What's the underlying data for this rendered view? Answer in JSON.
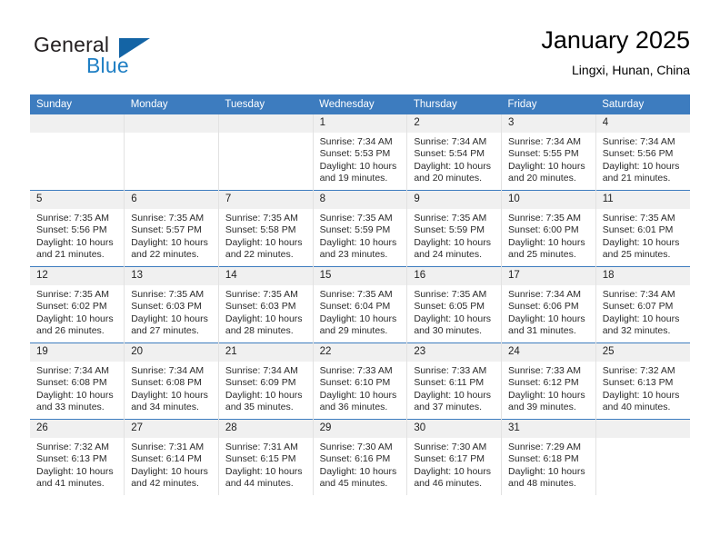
{
  "logo": {
    "line1": "General",
    "line2": "Blue",
    "triangle_icon": "triangle-icon",
    "color_dark": "#231f20",
    "color_blue": "#1f7fc4",
    "color_triangle": "#1464a5"
  },
  "header": {
    "title": "January 2025",
    "subtitle": "Lingxi, Hunan, China"
  },
  "theme": {
    "header_blue": "#3d7cbf",
    "daynum_bg": "#f0f0f0",
    "cell_bg": "#ffffff",
    "text": "#2a2a2a"
  },
  "weekdays": [
    "Sunday",
    "Monday",
    "Tuesday",
    "Wednesday",
    "Thursday",
    "Friday",
    "Saturday"
  ],
  "weeks": [
    [
      {
        "day": "",
        "blank": true
      },
      {
        "day": "",
        "blank": true
      },
      {
        "day": "",
        "blank": true
      },
      {
        "day": "1",
        "sunrise": "Sunrise: 7:34 AM",
        "sunset": "Sunset: 5:53 PM",
        "daylight": "Daylight: 10 hours and 19 minutes."
      },
      {
        "day": "2",
        "sunrise": "Sunrise: 7:34 AM",
        "sunset": "Sunset: 5:54 PM",
        "daylight": "Daylight: 10 hours and 20 minutes."
      },
      {
        "day": "3",
        "sunrise": "Sunrise: 7:34 AM",
        "sunset": "Sunset: 5:55 PM",
        "daylight": "Daylight: 10 hours and 20 minutes."
      },
      {
        "day": "4",
        "sunrise": "Sunrise: 7:34 AM",
        "sunset": "Sunset: 5:56 PM",
        "daylight": "Daylight: 10 hours and 21 minutes."
      }
    ],
    [
      {
        "day": "5",
        "sunrise": "Sunrise: 7:35 AM",
        "sunset": "Sunset: 5:56 PM",
        "daylight": "Daylight: 10 hours and 21 minutes."
      },
      {
        "day": "6",
        "sunrise": "Sunrise: 7:35 AM",
        "sunset": "Sunset: 5:57 PM",
        "daylight": "Daylight: 10 hours and 22 minutes."
      },
      {
        "day": "7",
        "sunrise": "Sunrise: 7:35 AM",
        "sunset": "Sunset: 5:58 PM",
        "daylight": "Daylight: 10 hours and 22 minutes."
      },
      {
        "day": "8",
        "sunrise": "Sunrise: 7:35 AM",
        "sunset": "Sunset: 5:59 PM",
        "daylight": "Daylight: 10 hours and 23 minutes."
      },
      {
        "day": "9",
        "sunrise": "Sunrise: 7:35 AM",
        "sunset": "Sunset: 5:59 PM",
        "daylight": "Daylight: 10 hours and 24 minutes."
      },
      {
        "day": "10",
        "sunrise": "Sunrise: 7:35 AM",
        "sunset": "Sunset: 6:00 PM",
        "daylight": "Daylight: 10 hours and 25 minutes."
      },
      {
        "day": "11",
        "sunrise": "Sunrise: 7:35 AM",
        "sunset": "Sunset: 6:01 PM",
        "daylight": "Daylight: 10 hours and 25 minutes."
      }
    ],
    [
      {
        "day": "12",
        "sunrise": "Sunrise: 7:35 AM",
        "sunset": "Sunset: 6:02 PM",
        "daylight": "Daylight: 10 hours and 26 minutes."
      },
      {
        "day": "13",
        "sunrise": "Sunrise: 7:35 AM",
        "sunset": "Sunset: 6:03 PM",
        "daylight": "Daylight: 10 hours and 27 minutes."
      },
      {
        "day": "14",
        "sunrise": "Sunrise: 7:35 AM",
        "sunset": "Sunset: 6:03 PM",
        "daylight": "Daylight: 10 hours and 28 minutes."
      },
      {
        "day": "15",
        "sunrise": "Sunrise: 7:35 AM",
        "sunset": "Sunset: 6:04 PM",
        "daylight": "Daylight: 10 hours and 29 minutes."
      },
      {
        "day": "16",
        "sunrise": "Sunrise: 7:35 AM",
        "sunset": "Sunset: 6:05 PM",
        "daylight": "Daylight: 10 hours and 30 minutes."
      },
      {
        "day": "17",
        "sunrise": "Sunrise: 7:34 AM",
        "sunset": "Sunset: 6:06 PM",
        "daylight": "Daylight: 10 hours and 31 minutes."
      },
      {
        "day": "18",
        "sunrise": "Sunrise: 7:34 AM",
        "sunset": "Sunset: 6:07 PM",
        "daylight": "Daylight: 10 hours and 32 minutes."
      }
    ],
    [
      {
        "day": "19",
        "sunrise": "Sunrise: 7:34 AM",
        "sunset": "Sunset: 6:08 PM",
        "daylight": "Daylight: 10 hours and 33 minutes."
      },
      {
        "day": "20",
        "sunrise": "Sunrise: 7:34 AM",
        "sunset": "Sunset: 6:08 PM",
        "daylight": "Daylight: 10 hours and 34 minutes."
      },
      {
        "day": "21",
        "sunrise": "Sunrise: 7:34 AM",
        "sunset": "Sunset: 6:09 PM",
        "daylight": "Daylight: 10 hours and 35 minutes."
      },
      {
        "day": "22",
        "sunrise": "Sunrise: 7:33 AM",
        "sunset": "Sunset: 6:10 PM",
        "daylight": "Daylight: 10 hours and 36 minutes."
      },
      {
        "day": "23",
        "sunrise": "Sunrise: 7:33 AM",
        "sunset": "Sunset: 6:11 PM",
        "daylight": "Daylight: 10 hours and 37 minutes."
      },
      {
        "day": "24",
        "sunrise": "Sunrise: 7:33 AM",
        "sunset": "Sunset: 6:12 PM",
        "daylight": "Daylight: 10 hours and 39 minutes."
      },
      {
        "day": "25",
        "sunrise": "Sunrise: 7:32 AM",
        "sunset": "Sunset: 6:13 PM",
        "daylight": "Daylight: 10 hours and 40 minutes."
      }
    ],
    [
      {
        "day": "26",
        "sunrise": "Sunrise: 7:32 AM",
        "sunset": "Sunset: 6:13 PM",
        "daylight": "Daylight: 10 hours and 41 minutes."
      },
      {
        "day": "27",
        "sunrise": "Sunrise: 7:31 AM",
        "sunset": "Sunset: 6:14 PM",
        "daylight": "Daylight: 10 hours and 42 minutes."
      },
      {
        "day": "28",
        "sunrise": "Sunrise: 7:31 AM",
        "sunset": "Sunset: 6:15 PM",
        "daylight": "Daylight: 10 hours and 44 minutes."
      },
      {
        "day": "29",
        "sunrise": "Sunrise: 7:30 AM",
        "sunset": "Sunset: 6:16 PM",
        "daylight": "Daylight: 10 hours and 45 minutes."
      },
      {
        "day": "30",
        "sunrise": "Sunrise: 7:30 AM",
        "sunset": "Sunset: 6:17 PM",
        "daylight": "Daylight: 10 hours and 46 minutes."
      },
      {
        "day": "31",
        "sunrise": "Sunrise: 7:29 AM",
        "sunset": "Sunset: 6:18 PM",
        "daylight": "Daylight: 10 hours and 48 minutes."
      },
      {
        "day": "",
        "blank": true
      }
    ]
  ]
}
